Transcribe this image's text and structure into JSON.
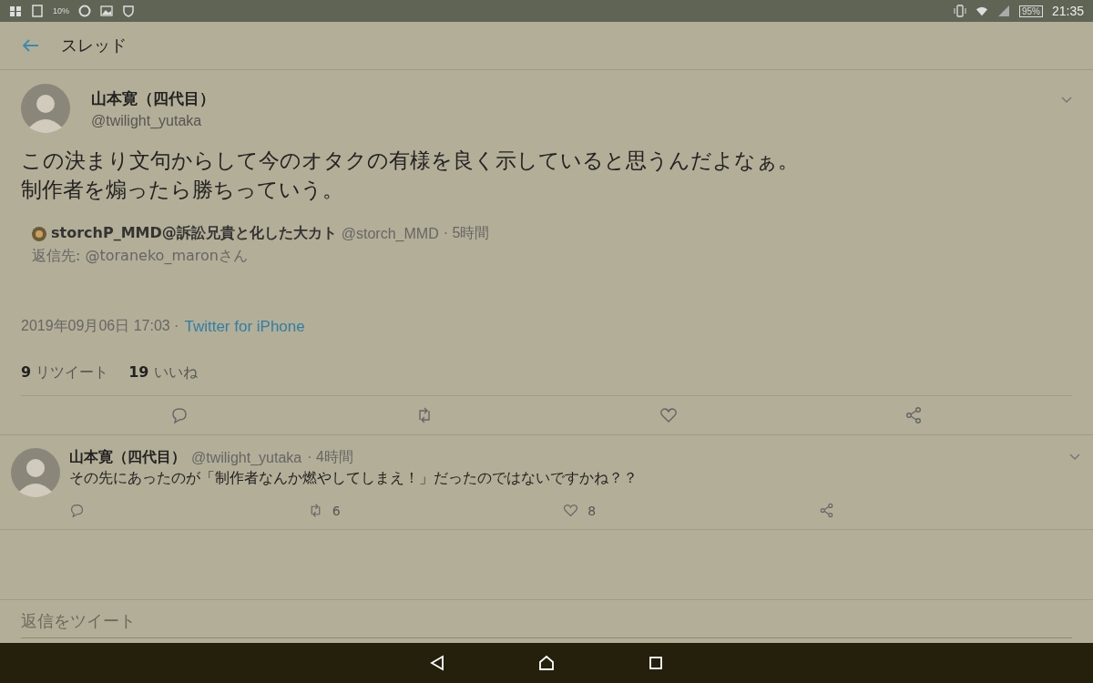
{
  "status_bar": {
    "left_badge": "10%",
    "battery": "95%",
    "time": "21:35"
  },
  "header": {
    "title": "スレッド"
  },
  "tweet": {
    "name": "山本寛（四代目）",
    "handle": "@twilight_yutaka",
    "text_lines": [
      "この決まり文句からして今のオタクの有様を良く示していると思うんだよなぁ。",
      "制作者を煽ったら勝ちっていう。"
    ],
    "quoted": {
      "name": "storchP_MMD@訴訟兄貴と化した大カト",
      "handle": "@storch_MMD",
      "time": "· 5時間",
      "reply_to": "返信先: @toraneko_maronさん"
    },
    "date": "2019年09月06日 17:03 ·",
    "source": "Twitter for iPhone",
    "stats": [
      {
        "count": "9",
        "label": "リツイート"
      },
      {
        "count": "19",
        "label": "いいね"
      }
    ]
  },
  "reply": {
    "name": "山本寛（四代目）",
    "handle": "@twilight_yutaka",
    "time": "· 4時間",
    "text": "その先にあったのが「制作者なんか燃やしてしまえ！」だったのではないですかね？？",
    "retweets": "6",
    "likes": "8"
  },
  "composer": {
    "placeholder": "返信をツイート"
  }
}
